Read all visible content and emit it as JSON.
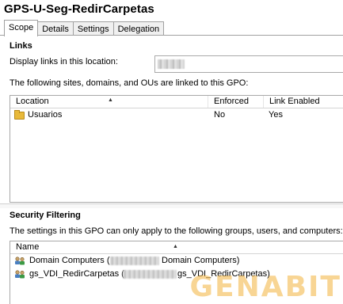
{
  "window": {
    "title": "GPS-U-Seg-RedirCarpetas"
  },
  "tabs": [
    {
      "label": "Scope",
      "active": true
    },
    {
      "label": "Details",
      "active": false
    },
    {
      "label": "Settings",
      "active": false
    },
    {
      "label": "Delegation",
      "active": false
    }
  ],
  "links": {
    "heading": "Links",
    "location_label": "Display links in this location:",
    "linked_text": "The following sites, domains, and OUs are linked to this GPO:",
    "columns": [
      "Location",
      "Enforced",
      "Link Enabled"
    ],
    "rows": [
      {
        "location": "Usuarios",
        "enforced": "No",
        "link_enabled": "Yes",
        "icon": "ou-folder-icon"
      }
    ]
  },
  "security": {
    "heading": "Security Filtering",
    "description": "The settings in this GPO can only apply to the following groups, users, and computers:",
    "columns": [
      "Name"
    ],
    "rows": [
      {
        "name_start": "Domain Computers (",
        "name_end": "Domain Computers)",
        "icon": "group-icon"
      },
      {
        "name_start": "gs_VDI_RedirCarpetas (",
        "name_end": "gs_VDI_RedirCarpetas)",
        "icon": "group-icon"
      }
    ]
  },
  "watermark": {
    "text": "GENABIT"
  },
  "colors": {
    "tab_border": "#a0a0a0",
    "folder": "#e8b93a",
    "watermark": "#f3b33d"
  }
}
